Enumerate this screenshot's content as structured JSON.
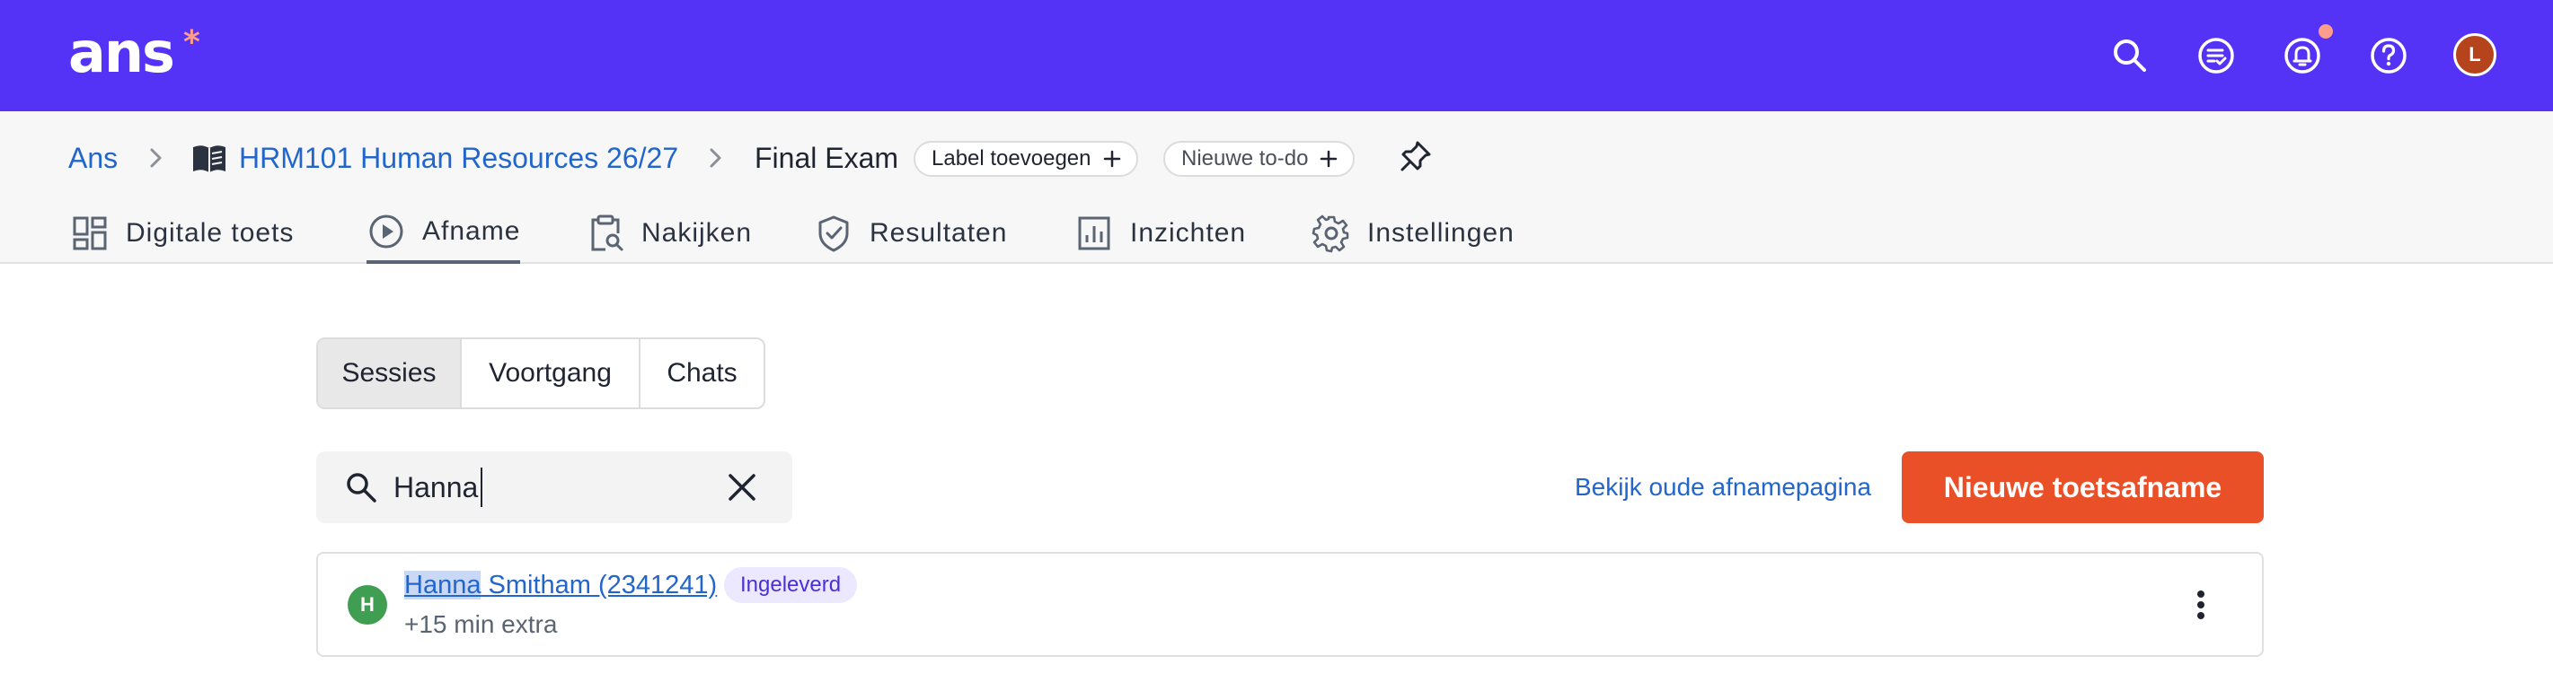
{
  "topbar": {
    "logo_text": "ans",
    "logo_star": "*",
    "brand_color": "#5433f6",
    "icons": [
      "search-icon",
      "checklist-icon",
      "bell-icon",
      "help-icon"
    ],
    "notification_dot_color": "#ff9d8c",
    "avatar_initial": "L"
  },
  "breadcrumb": {
    "root": "Ans",
    "course": "HRM101 Human Resources 26/27",
    "current": "Final Exam",
    "label_pill": "Label toevoegen",
    "todo_pill": "Nieuwe to-do"
  },
  "tabs": [
    {
      "label": "Digitale toets",
      "icon": "dashboard-icon"
    },
    {
      "label": "Afname",
      "icon": "play-circle-icon",
      "active": true
    },
    {
      "label": "Nakijken",
      "icon": "clipboard-search-icon"
    },
    {
      "label": "Resultaten",
      "icon": "shield-check-icon"
    },
    {
      "label": "Inzichten",
      "icon": "bar-chart-icon"
    },
    {
      "label": "Instellingen",
      "icon": "gear-icon"
    }
  ],
  "segments": [
    {
      "label": "Sessies",
      "selected": true
    },
    {
      "label": "Voortgang"
    },
    {
      "label": "Chats"
    }
  ],
  "search": {
    "value": "Hanna"
  },
  "actions": {
    "old_page_link": "Bekijk oude afnamepagina",
    "new_button": "Nieuwe toetsafname",
    "button_color": "#ea5028"
  },
  "results": [
    {
      "avatar_initial": "H",
      "avatar_color": "#3f9e52",
      "name_highlight": "Hanna",
      "name_rest": " Smitham (2341241)",
      "status": "Ingeleverd",
      "extra_time": "+15 min extra"
    }
  ]
}
